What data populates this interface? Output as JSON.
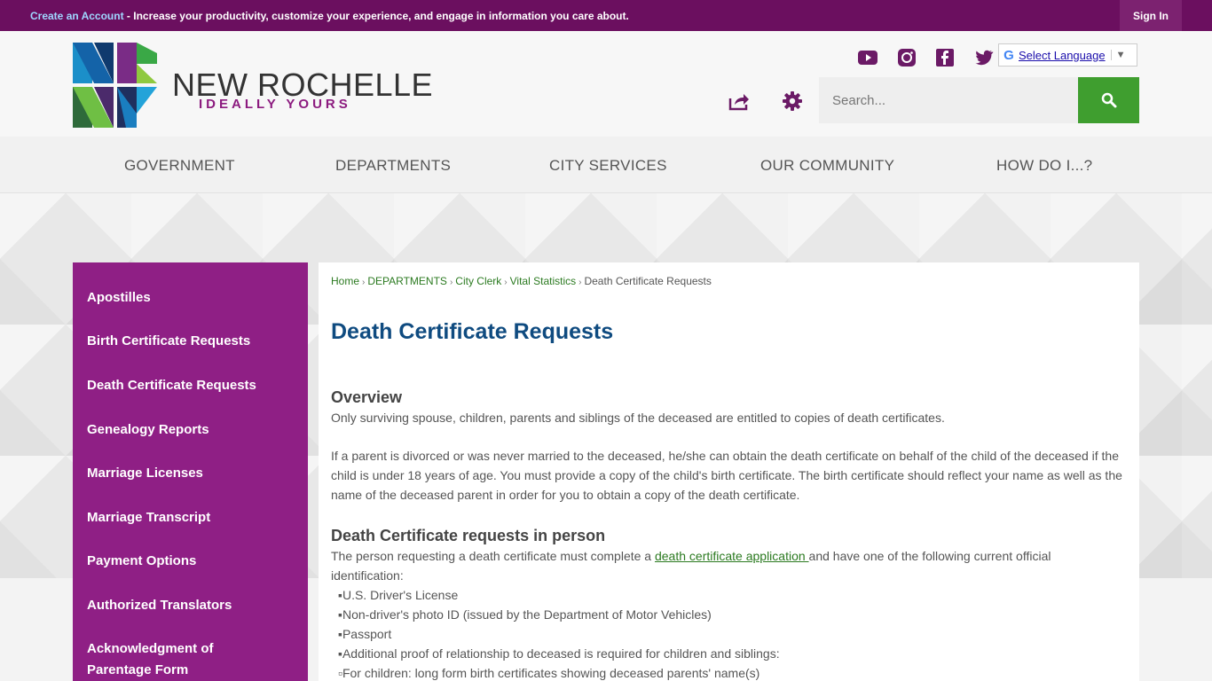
{
  "topbar": {
    "create_account": "Create an Account",
    "message": " - Increase your productivity, customize your experience, and engage in information you care about.",
    "sign_in": "Sign In"
  },
  "header": {
    "brand_name": "NEW ROCHELLE",
    "brand_tagline": "IDEALLY YOURS",
    "language_label": "Select Language",
    "search_placeholder": "Search..."
  },
  "nav": {
    "items": [
      "GOVERNMENT",
      "DEPARTMENTS",
      "CITY SERVICES",
      "OUR COMMUNITY",
      "HOW DO I...?"
    ]
  },
  "sidebar": {
    "items": [
      "Apostilles",
      "Birth Certificate Requests",
      "Death Certificate Requests",
      "Genealogy Reports",
      "Marriage Licenses",
      "Marriage Transcript",
      "Payment Options",
      "Authorized Translators",
      "Acknowledgment of Parentage Form"
    ]
  },
  "breadcrumb": {
    "items": [
      "Home",
      "DEPARTMENTS",
      "City Clerk",
      "Vital Statistics"
    ],
    "current": "Death Certificate Requests"
  },
  "page": {
    "title": "Death Certificate Requests",
    "overview_heading": "Overview",
    "overview_p1": "Only surviving spouse, children, parents and siblings of the deceased are entitled to copies of death certificates.",
    "overview_p2": "If a parent is divorced or was never married to the deceased, he/she can obtain the death certificate on behalf of the child of the deceased if the child is under 18 years of age.  You must provide a copy of the child's birth certificate.  The birth certificate should reflect your name as well as the name of the deceased parent in order for you to obtain a copy of the death certificate.",
    "in_person_heading": "Death Certificate requests in person",
    "in_person_pre": "The person requesting a death certificate must complete a ",
    "in_person_link": "death certificate application ",
    "in_person_post": "and have one of the following current official identification:",
    "id_list": [
      "U.S. Driver's License",
      "Non-driver's photo ID (issued by the Department of Motor Vehicles)",
      "Passport",
      "Additional proof of relationship to deceased is required for children and siblings:",
      "For children: long form birth certificates showing deceased parents' name(s)"
    ]
  },
  "colors": {
    "topbar": "#6b0f5f",
    "sidebar": "#8f1f85",
    "search_button": "#3f9e2f",
    "title": "#0f4b80"
  }
}
